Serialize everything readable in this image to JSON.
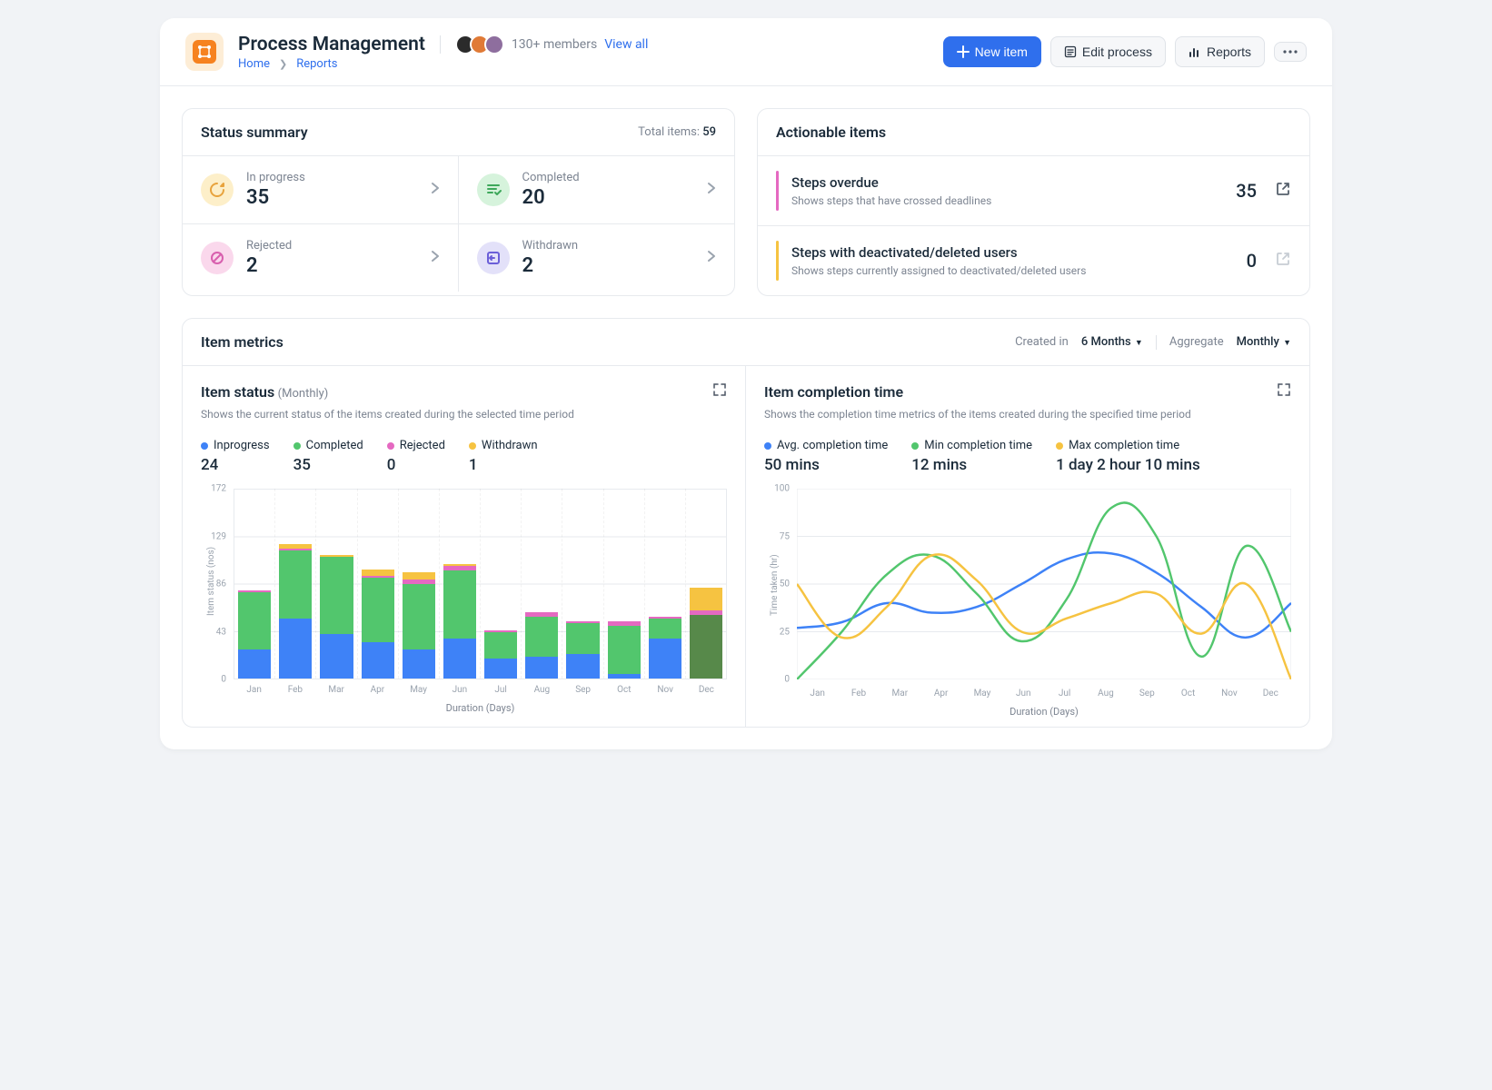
{
  "header": {
    "title": "Process Management",
    "members_text": "130+ members",
    "view_all": "View all",
    "breadcrumb": [
      "Home",
      "Reports"
    ],
    "buttons": {
      "new_item": "New item",
      "edit_process": "Edit process",
      "reports": "Reports"
    },
    "avatars": [
      {
        "bg": "#2b2b2b"
      },
      {
        "bg": "#e07a36"
      },
      {
        "bg": "#8e6e9e"
      }
    ]
  },
  "status_summary": {
    "title": "Status summary",
    "total_label": "Total items:",
    "total_value": "59",
    "items": [
      {
        "label": "In progress",
        "value": "35",
        "icon": "progress",
        "bg": "#FDEFC9",
        "fg": "#E8A33D"
      },
      {
        "label": "Completed",
        "value": "20",
        "icon": "check",
        "bg": "#D6F3DC",
        "fg": "#3EA85B"
      },
      {
        "label": "Rejected",
        "value": "2",
        "icon": "reject",
        "bg": "#FAD8EC",
        "fg": "#D85FAE"
      },
      {
        "label": "Withdrawn",
        "value": "2",
        "icon": "withdraw",
        "bg": "#E3E1F9",
        "fg": "#6B5FD8"
      }
    ]
  },
  "actionable": {
    "title": "Actionable items",
    "items": [
      {
        "title": "Steps overdue",
        "desc": "Shows steps that have crossed deadlines",
        "count": "35",
        "bar": "#E569C1",
        "enabled": true
      },
      {
        "title": "Steps with deactivated/deleted users",
        "desc": "Shows steps currently assigned to deactivated/deleted users",
        "count": "0",
        "bar": "#F6C341",
        "enabled": false
      }
    ]
  },
  "metrics": {
    "title": "Item metrics",
    "created_in_label": "Created in",
    "created_in_value": "6 Months",
    "aggregate_label": "Aggregate",
    "aggregate_value": "Monthly"
  },
  "item_status": {
    "title": "Item status",
    "sub": "(Monthly)",
    "desc": "Shows the current status of the items created during the selected time period",
    "legend": [
      {
        "label": "Inprogress",
        "value": "24",
        "color": "#3E82F7"
      },
      {
        "label": "Completed",
        "value": "35",
        "color": "#52C66D"
      },
      {
        "label": "Rejected",
        "value": "0",
        "color": "#E569C1"
      },
      {
        "label": "Withdrawn",
        "value": "1",
        "color": "#F6C341"
      }
    ],
    "y_label": "Item status (nos)",
    "x_label": "Duration (Days)",
    "y_ticks": [
      "0",
      "43",
      "86",
      "129",
      "172"
    ]
  },
  "completion": {
    "title": "Item completion time",
    "desc": "Shows the completion time metrics of the items created during the specified time period",
    "legend": [
      {
        "label": "Avg. completion time",
        "value": "50 mins",
        "color": "#3E82F7"
      },
      {
        "label": "Min completion time",
        "value": "12 mins",
        "color": "#52C66D"
      },
      {
        "label": "Max completion time",
        "value": "1 day 2 hour 10 mins",
        "color": "#F6C341"
      }
    ],
    "y_label": "Time taken (hr)",
    "x_label": "Duration (Days)",
    "y_ticks": [
      "0",
      "25",
      "50",
      "75",
      "100"
    ]
  },
  "chart_data": [
    {
      "type": "bar",
      "title": "Item status (Monthly)",
      "xlabel": "Duration (Days)",
      "ylabel": "Item status (nos)",
      "ylim": [
        0,
        172
      ],
      "categories": [
        "Jan",
        "Feb",
        "Mar",
        "Apr",
        "May",
        "Jun",
        "Jul",
        "Aug",
        "Sep",
        "Oct",
        "Nov",
        "Dec"
      ],
      "series": [
        {
          "name": "Inprogress",
          "color": "#3E82F7",
          "values": [
            26,
            54,
            40,
            33,
            26,
            36,
            18,
            20,
            22,
            4,
            36,
            0
          ]
        },
        {
          "name": "Completed",
          "color": "#52C66D",
          "values": [
            52,
            62,
            70,
            58,
            60,
            62,
            24,
            36,
            28,
            44,
            18,
            58
          ]
        },
        {
          "name": "Rejected",
          "color": "#E569C1",
          "values": [
            2,
            2,
            0,
            2,
            4,
            4,
            2,
            4,
            2,
            4,
            2,
            4
          ]
        },
        {
          "name": "Withdrawn",
          "color": "#F6C341",
          "values": [
            0,
            4,
            2,
            6,
            6,
            2,
            0,
            0,
            0,
            0,
            0,
            20
          ]
        }
      ],
      "highlight_index": 11,
      "highlight_completed_color": "#57894a"
    },
    {
      "type": "line",
      "title": "Item completion time",
      "xlabel": "Duration (Days)",
      "ylabel": "Time taken (hr)",
      "ylim": [
        0,
        100
      ],
      "x": [
        "Jan",
        "Feb",
        "Mar",
        "Apr",
        "May",
        "Jun",
        "Jul",
        "Aug",
        "Sep",
        "Oct",
        "Nov",
        "Dec"
      ],
      "series": [
        {
          "name": "Avg. completion time",
          "color": "#3E82F7",
          "values": [
            27,
            30,
            40,
            35,
            38,
            50,
            63,
            66,
            56,
            38,
            22,
            40
          ]
        },
        {
          "name": "Min completion time",
          "color": "#52C66D",
          "values": [
            0,
            25,
            55,
            65,
            45,
            20,
            42,
            90,
            75,
            12,
            70,
            25
          ]
        },
        {
          "name": "Max completion time",
          "color": "#F6C341",
          "values": [
            50,
            22,
            38,
            65,
            52,
            25,
            32,
            40,
            45,
            24,
            50,
            0
          ]
        }
      ]
    }
  ]
}
